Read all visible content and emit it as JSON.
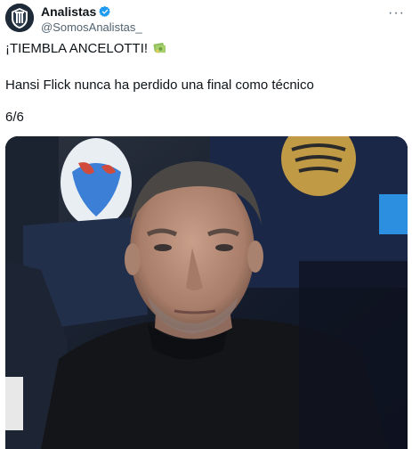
{
  "author": {
    "display_name": "Analistas",
    "handle": "@SomosAnalistas_",
    "verified_icon": "verified-badge-icon",
    "avatar_icon": "club-crest-avatar"
  },
  "menu": {
    "icon": "more-options-icon",
    "glyph": "···"
  },
  "tweet": {
    "line1": "¡TIEMBLA ANCELOTTI!",
    "line1_emoji": "money-emoji-icon",
    "line2": "Hansi Flick nunca ha perdido una final como técnico",
    "line3": "6/6"
  },
  "media": {
    "subject": "photo-of-coach",
    "accent": "#1d9bf0"
  }
}
